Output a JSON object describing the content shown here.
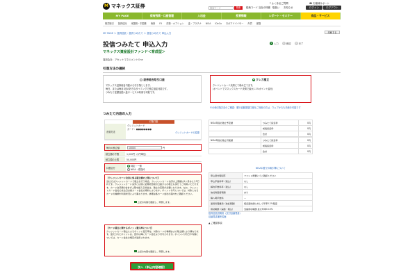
{
  "header": {
    "logo_letter": "M",
    "logo_text": "マネックス証券",
    "search_placeholder": "検索ワード",
    "search_btn": "検索",
    "links": [
      "銘柄コード",
      "当社の特徴",
      "取扱い",
      "お知らせ"
    ],
    "help": "よくあるご質問",
    "customer": "お客様サポート",
    "login": "ログイン",
    "logout": "ログアウト"
  },
  "gnav": [
    {
      "label": "MY PAGE"
    },
    {
      "label": "保有残高・口座管理"
    },
    {
      "label": "入出金"
    },
    {
      "label": "投資情報"
    },
    {
      "label": "レポート・セミナー"
    },
    {
      "label": "商品・サービス"
    }
  ],
  "subnav": [
    "株式取引",
    "投資信託",
    "米国株・中国株",
    "債券",
    "FX",
    "先物・オプション",
    "金・プラチナ",
    "NISA",
    "iDeCo",
    "ロボアドバイザー",
    "外貨",
    "保険"
  ],
  "breadcrumb": "MY PAGE ＞ 投資信託・投資つみたて ＞ 投信つみたて 申込入力",
  "print": "印刷する",
  "title": "投信つみたて 申込入力",
  "fund_name": "マネックス資産設計ファンド＜育成型＞",
  "company": "運用会社：アセットマネジメントOne",
  "steps": [
    {
      "num": "1",
      "label": "入力"
    },
    {
      "num": "2",
      "label": "確認"
    },
    {
      "num": "3",
      "label": "完了"
    }
  ],
  "method_section": "引落方法の選択",
  "option_bank": {
    "title": "証券総合取引口座",
    "text1": "マネックス証券総合口座から引き落とします。",
    "text2": "毎日、または毎月1回の好きなタイミングで積立設定可能です。",
    "text3": "つみたて定額自動入金サービスの利用も可能です。"
  },
  "option_card": {
    "title": "クレカ積立",
    "text1": "クレジットカード決済にて積み立てます。",
    "text2": "(ポイントでマネックスカード決済で最大1.1%ポイント還元)"
  },
  "method_link": "その他引落方法のご確認：銀行自動振替口座をご利用の方は、ウェブからも手続き可能です",
  "input_section": "つみたて内容の入力",
  "pay": {
    "header": "引落口座",
    "label": "決済方法",
    "card_type": "クレジットカード",
    "card_label": "カード：",
    "card_mask": "●●●●●●●●",
    "card_link": "クレジットカードの変更"
  },
  "amount": {
    "label": "毎月の積立額",
    "value": "10000",
    "unit": "円"
  },
  "lower": {
    "label": "積立額の下限",
    "value": "1,000円（1円単位）"
  },
  "upper": {
    "label": "積立額の上限",
    "value": "50,000円"
  },
  "account": {
    "label": "口座区分",
    "opt1": "特定・一般",
    "opt2": "NISA・成長枠"
  },
  "notice1": {
    "title": "【クレジットカード決済に係る積立額の上限について】",
    "body": "当社ではクレジットカードで積立を行う場合、クレジットカード決済の上限額は1ヶ月あたり5万円です。クレジットカード決済とは別に証券総合取引口座からの積立も併せてご利用いただけます。カード決済額の合計が上限を超える場合は、積立の変更が必要になります。なお、クレジットカード会社の支払日は各カード会社の規約によります。ポイント付与については、対象となるカードの種類や利用状況により異なります。詳細は各カード会社の案内をご確認ください。",
    "check": "上記の内容を確認し、同意します。"
  },
  "notice2": {
    "title": "【カード積立に関するポイント還元率について】",
    "body": "クレジットカード積立によるポイント還元率は、対象カードの種類および積立額により異なります。還元されたポイントは、翌月以降にカード会社より付与されます。ポイント付与日や内容については、カード会社の規定が適用されます。",
    "check": "上記の内容を確認し、同意します。"
  },
  "next_btn": "次へ（申込内容確認）",
  "right_table1": {
    "rows": [
      {
        "c1": "NISA年間の積立予定額",
        "c2": "つみたて投資枠",
        "c3": "0円"
      },
      {
        "c1": "",
        "c2": "成長投資枠",
        "c3": "0円"
      },
      {
        "c1": "",
        "c2": "合計",
        "c3": "0円"
      }
    ]
  },
  "right_table2": {
    "rows": [
      {
        "c1": "NISA年間の積立可能額",
        "c2": "つみたて投資枠",
        "c3": "0円"
      },
      {
        "c1": "",
        "c2": "成長投資枠",
        "c3": "0円"
      },
      {
        "c1": "",
        "c2": "合計",
        "c3": "0円"
      }
    ]
  },
  "nisa_link": "NISA口座での取引率について",
  "fund_info": {
    "rows": [
      {
        "k": "申込受付時間帯",
        "v": "ファンド概要にてご確認ください"
      },
      {
        "k": "申込手数料率（税込）",
        "v": "なし"
      },
      {
        "k": "解約手数料率（税込）",
        "v": "なし"
      },
      {
        "k": "信託財産留保額",
        "v": "あり"
      },
      {
        "k": "購入時手数料",
        "v": "－"
      },
      {
        "k": "運用管理費用（信託報酬）",
        "v": "純資産総額に対して年率0.2%程度"
      },
      {
        "k": "成功報酬（実績・税込）",
        "v": "当該成功報酬 最大年率0.10%"
      }
    ]
  },
  "doc_links": [
    "投資信託説明書（交付目論見書）",
    "目論見書補完書面"
  ],
  "side_hint": "ご確認事項"
}
